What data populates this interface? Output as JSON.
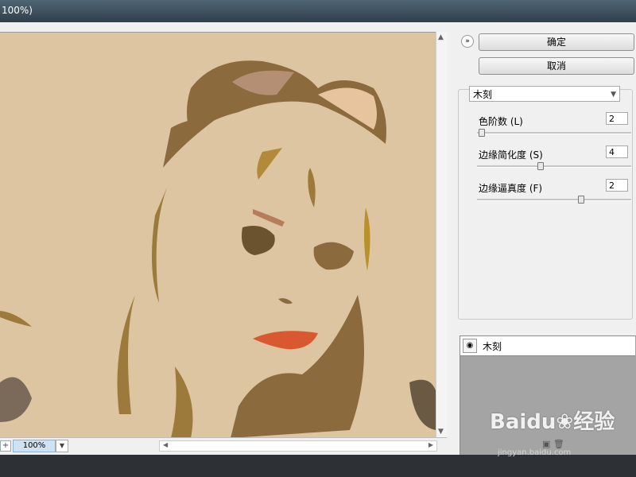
{
  "window": {
    "title": "100%)"
  },
  "buttons": {
    "ok": "确定",
    "cancel": "取消",
    "collapse_icon": "chevron-double-icon"
  },
  "filter": {
    "selected": "木刻",
    "params": [
      {
        "label": "色阶数 (L)",
        "value": "2",
        "level": 0.0
      },
      {
        "label": "边缘简化度 (S)",
        "value": "4",
        "level": 0.4
      },
      {
        "label": "边缘逼真度 (F)",
        "value": "2",
        "level": 0.67
      }
    ]
  },
  "layers": [
    {
      "name": "木刻"
    }
  ],
  "preview": {
    "zoom": "100%"
  },
  "watermark": {
    "brand": "Bai",
    "brand_mark": "du",
    "cn": "经验",
    "url": "jingyan.baidu.com"
  },
  "colors": {
    "canvas": "#dcc5a0",
    "hair": "#8b6a3d",
    "lips": "#d9582f",
    "glasses_lens": "#e7c49e"
  }
}
